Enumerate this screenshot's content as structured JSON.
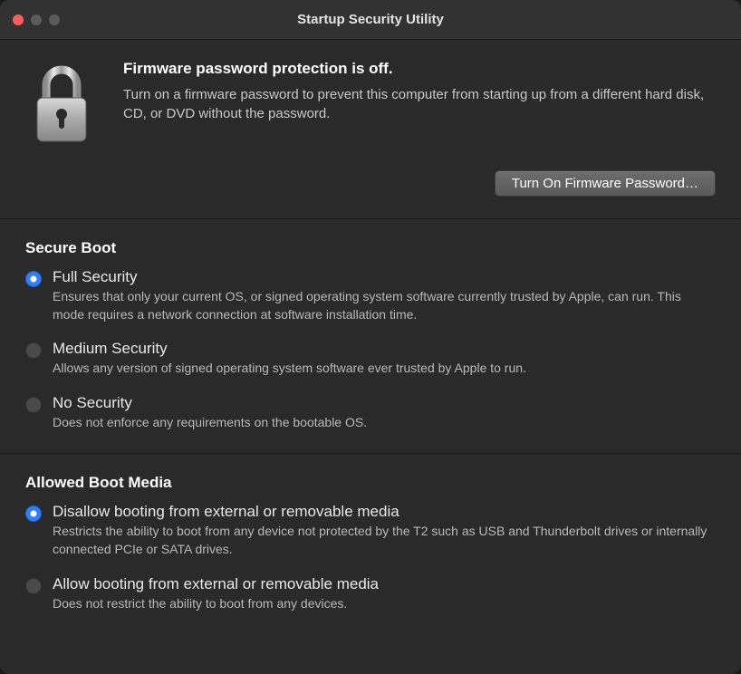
{
  "window": {
    "title": "Startup Security Utility"
  },
  "firmware": {
    "heading": "Firmware password protection is off.",
    "description": "Turn on a firmware password to prevent this computer from starting up from a different hard disk, CD, or DVD without the password.",
    "button_label": "Turn On Firmware Password…"
  },
  "secure_boot": {
    "heading": "Secure Boot",
    "options": [
      {
        "label": "Full Security",
        "description": "Ensures that only your current OS, or signed operating system software currently trusted by Apple, can run. This mode requires a network connection at software installation time.",
        "selected": true
      },
      {
        "label": "Medium Security",
        "description": "Allows any version of signed operating system software ever trusted by Apple to run.",
        "selected": false
      },
      {
        "label": "No Security",
        "description": "Does not enforce any requirements on the bootable OS.",
        "selected": false
      }
    ]
  },
  "boot_media": {
    "heading": "Allowed Boot Media",
    "options": [
      {
        "label": "Disallow booting from external or removable media",
        "description": "Restricts the ability to boot from any device not protected by the T2 such as USB and Thunderbolt drives or internally connected PCIe or SATA drives.",
        "selected": true
      },
      {
        "label": "Allow booting from external or removable media",
        "description": "Does not restrict the ability to boot from any devices.",
        "selected": false
      }
    ]
  }
}
